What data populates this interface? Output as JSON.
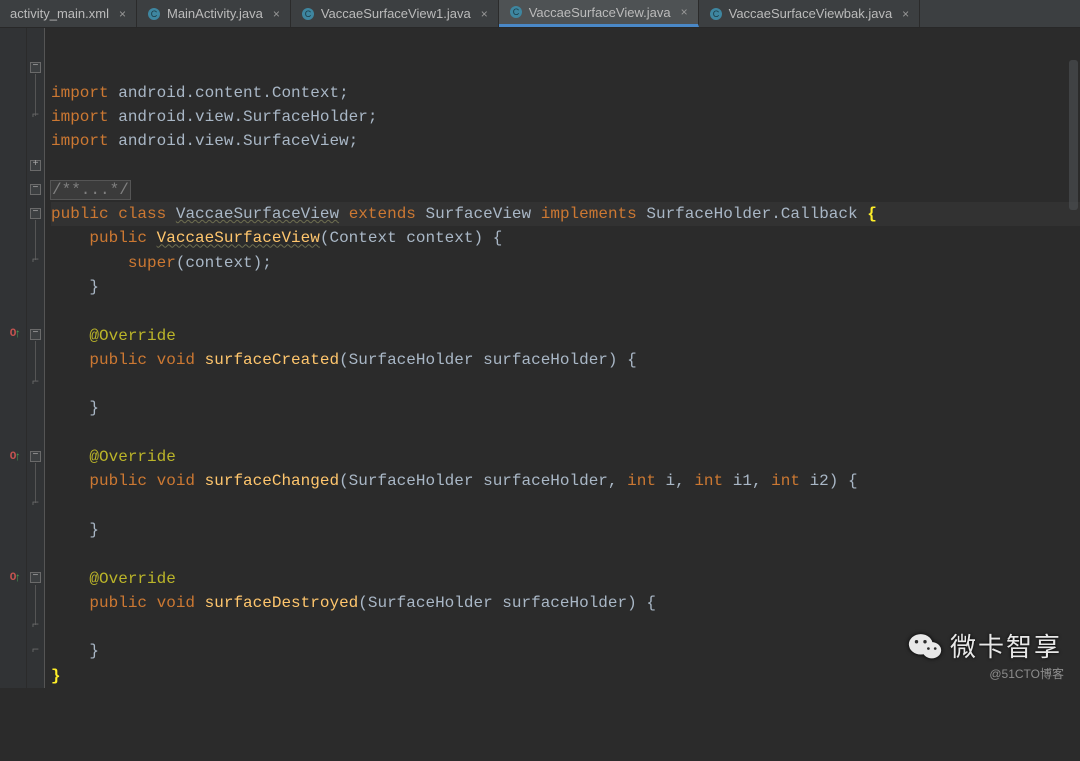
{
  "tabs": [
    {
      "label": "activity_main.xml",
      "icon": "xml",
      "active": false
    },
    {
      "label": "MainActivity.java",
      "icon": "java",
      "active": false
    },
    {
      "label": "VaccaeSurfaceView1.java",
      "icon": "java",
      "active": false
    },
    {
      "label": "VaccaeSurfaceView.java",
      "icon": "java",
      "active": true
    },
    {
      "label": "VaccaeSurfaceViewbak.java",
      "icon": "java",
      "active": false
    }
  ],
  "code": {
    "imports": [
      {
        "pkg": "android.content.Context"
      },
      {
        "pkg": "android.view.SurfaceHolder"
      },
      {
        "pkg": "android.view.SurfaceView"
      }
    ],
    "folded_comment": "/**...*/",
    "class_kw_public": "public",
    "class_kw_class": "class",
    "class_name": "VaccaeSurfaceView",
    "extends_kw": "extends",
    "super_class": "SurfaceView",
    "implements_kw": "implements",
    "iface": "SurfaceHolder.Callback",
    "ctor": {
      "mod": "public",
      "name": "VaccaeSurfaceView",
      "params": "(Context context)",
      "body_call": "super",
      "body_args": "(context);"
    },
    "override_annotation": "@Override",
    "m1": {
      "mod": "public",
      "ret": "void",
      "name": "surfaceCreated",
      "params": "(SurfaceHolder surfaceHolder)"
    },
    "m2": {
      "mod": "public",
      "ret": "void",
      "name": "surfaceChanged",
      "params": "(SurfaceHolder surfaceHolder, ",
      "int_kw": "int",
      "p2": " i, ",
      "p3": " i1, ",
      "p4": " i2)"
    },
    "m3": {
      "mod": "public",
      "ret": "void",
      "name": "surfaceDestroyed",
      "params": "(SurfaceHolder surfaceHolder)"
    }
  },
  "import_kw": "import",
  "watermark": "微卡智享",
  "sub_watermark": "@51CTO博客"
}
